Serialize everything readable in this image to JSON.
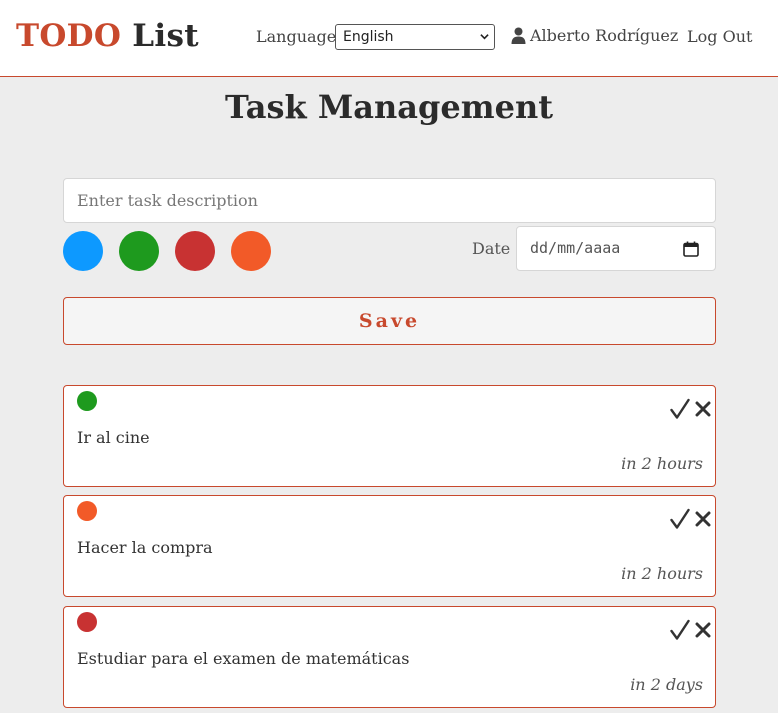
{
  "navbar": {
    "brand_part1": "TODO",
    "brand_part2": "List",
    "language_label": "Language",
    "language_selected": "English",
    "user_name": "Alberto Rodríguez",
    "logout_label": "Log Out"
  },
  "page_title": "Task Management",
  "form": {
    "description_placeholder": "Enter task description",
    "colors": [
      "#0d99ff",
      "#1e9a1e",
      "#c83232",
      "#f25a28"
    ],
    "date_label": "Date",
    "date_placeholder": "dd/mm/aaaa",
    "save_label": "Save"
  },
  "tasks": [
    {
      "color": "#1e9a1e",
      "description": "Ir al cine",
      "due": "in 2 hours"
    },
    {
      "color": "#f25a28",
      "description": "Hacer la compra",
      "due": "in 2 hours"
    },
    {
      "color": "#c83232",
      "description": "Estudiar para el examen de matemáticas",
      "due": "in 2 days"
    }
  ],
  "theme": {
    "accent": "#c8492d"
  }
}
